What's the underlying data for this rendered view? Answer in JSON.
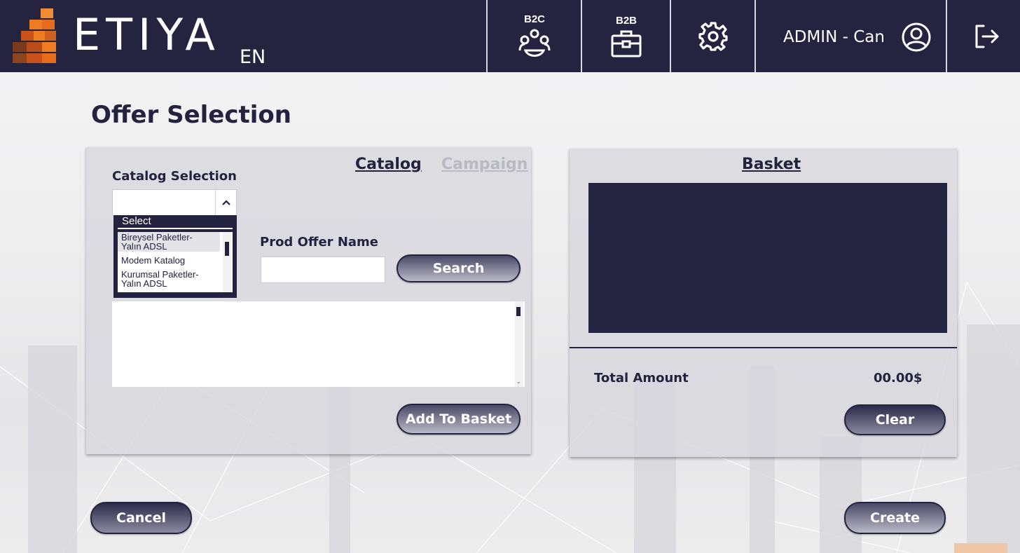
{
  "header": {
    "logo_text": "ETIYA",
    "language": "EN",
    "b2c_label": "B2C",
    "b2b_label": "B2B",
    "user_name": "ADMIN - Can"
  },
  "page": {
    "title": "Offer Selection"
  },
  "catalog_panel": {
    "tab_catalog": "Catalog",
    "tab_campaign": "Campaign",
    "catalog_selection_label": "Catalog Selection",
    "catalog_select_value": "",
    "dropdown_header": "Select",
    "dropdown_options": [
      "Bireysel Paketler-\nYalın ADSL",
      "Modem Katalog",
      "Kurumsal Paketler-\nYalın ADSL"
    ],
    "prod_offer_label": "Prod Offer Name",
    "prod_offer_value": "",
    "search_button": "Search",
    "add_to_basket_button": "Add To Basket"
  },
  "basket_panel": {
    "title": "Basket",
    "total_label": "Total Amount",
    "total_value": "00.00$",
    "clear_button": "Clear"
  },
  "footer": {
    "cancel_button": "Cancel",
    "create_button": "Create"
  },
  "colors": {
    "brand_navy": "#242340",
    "brand_orange": "#f07c22"
  },
  "icons": [
    "b2c-people-icon",
    "b2b-briefcase-icon",
    "settings-gear-icon",
    "user-avatar-icon",
    "logout-icon",
    "chevron-up-icon"
  ]
}
